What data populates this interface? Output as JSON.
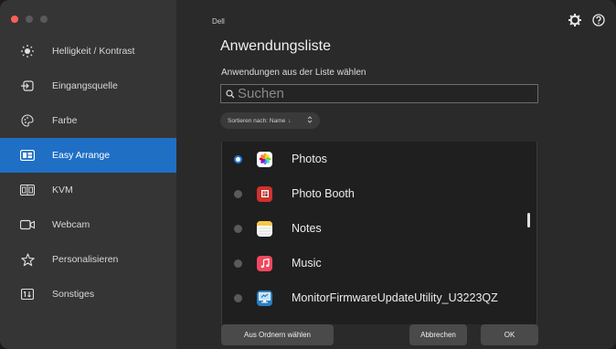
{
  "brand": "Dell",
  "sidebar": {
    "items": [
      {
        "label": "Helligkeit / Kontrast",
        "icon": "sun-icon",
        "active": false
      },
      {
        "label": "Eingangsquelle",
        "icon": "input-source-icon",
        "active": false
      },
      {
        "label": "Farbe",
        "icon": "palette-icon",
        "active": false
      },
      {
        "label": "Easy Arrange",
        "icon": "easy-arrange-icon",
        "active": true
      },
      {
        "label": "KVM",
        "icon": "kvm-icon",
        "active": false
      },
      {
        "label": "Webcam",
        "icon": "webcam-icon",
        "active": false
      },
      {
        "label": "Personalisieren",
        "icon": "star-icon",
        "active": false
      },
      {
        "label": "Sonstiges",
        "icon": "other-icon",
        "active": false
      }
    ]
  },
  "main": {
    "title": "Anwendungsliste",
    "subtitle": "Anwendungen aus der Liste wählen",
    "search": {
      "placeholder": "Suchen",
      "value": ""
    },
    "sort": {
      "label": "Sortieren nach: Name",
      "arrow": "↓"
    },
    "apps": [
      {
        "name": "Photos",
        "icon": "photos-icon",
        "selected": true
      },
      {
        "name": "Photo Booth",
        "icon": "photo-booth-icon",
        "selected": false
      },
      {
        "name": "Notes",
        "icon": "notes-icon",
        "selected": false
      },
      {
        "name": "Music",
        "icon": "music-icon",
        "selected": false
      },
      {
        "name": "MonitorFirmwareUpdateUtility_U3223QZ",
        "icon": "monitor-utility-icon",
        "selected": false
      }
    ],
    "buttons": {
      "folder": "Aus Ordnern wählen",
      "cancel": "Abbrechen",
      "ok": "OK"
    }
  },
  "colors": {
    "accent": "#1f6fc5",
    "sidebar_bg": "#353535",
    "main_bg": "#2a2a2a"
  }
}
